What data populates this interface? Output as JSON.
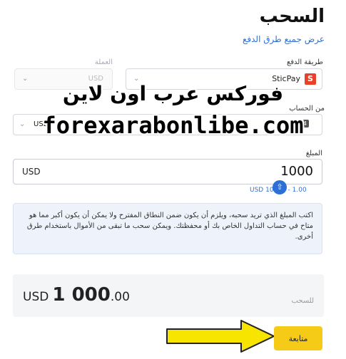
{
  "header": {
    "title": "السحب",
    "view_all_methods": "عرض جميع طرق الدفع"
  },
  "payment_method": {
    "label": "طريقة الدفع",
    "value": "SticPay",
    "logo_letter": "S"
  },
  "currency": {
    "label": "العملة",
    "value": "USD"
  },
  "from_account": {
    "label": "من الحساب",
    "value_currency": "USD",
    "badge": "MT4"
  },
  "amount": {
    "label": "المبلغ",
    "currency": "USD",
    "value": "1000",
    "limits_text": "USD 10 .00 - 1.00"
  },
  "info": {
    "text": "اكتب المبلغ الذي تريد سحبه، ويلزم أن يكون ضمن النطاق المفترح ولا يمكن أن يكون أكبر مما هو متاح في حساب التداول الخاص بك أو محفظتك. ويمكن سحب ما تبقى من الأموال باستخدام طرق أخرى."
  },
  "summary": {
    "label": "للسحب",
    "currency": "USD",
    "whole": "1 000",
    "decimals": ".00"
  },
  "actions": {
    "continue_label": "متابعة"
  },
  "watermark": {
    "line1": "فوركس عرب اون لاين",
    "line2": "forexarabonlibe.com"
  },
  "colors": {
    "accent_blue": "#2e6fd6",
    "button_yellow": "#f5cb17",
    "arrow_yellow": "#f7e500",
    "sticpay_red": "#e8412b"
  }
}
